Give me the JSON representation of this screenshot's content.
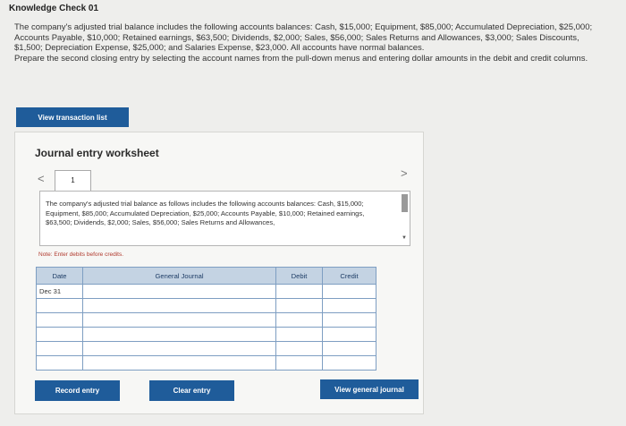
{
  "header": {
    "title": "Knowledge Check 01"
  },
  "problem": {
    "statement": "The company's adjusted trial balance includes the following accounts balances: Cash, $15,000; Equipment, $85,000; Accumulated Depreciation, $25,000; Accounts Payable, $10,000; Retained earnings, $63,500; Dividends, $2,000; Sales, $56,000; Sales Returns and Allowances, $3,000; Sales Discounts, $1,500; Depreciation Expense, $25,000; and Salaries Expense, $23,000. All accounts have normal balances.",
    "instruction": "Prepare the second closing entry by selecting the account names from the pull-down menus and entering dollar amounts in the debit and credit columns."
  },
  "buttons": {
    "view_transaction_list": "View transaction list",
    "record_entry": "Record entry",
    "clear_entry": "Clear entry",
    "view_general_journal": "View general journal"
  },
  "worksheet": {
    "title": "Journal entry worksheet",
    "nav_prev": "<",
    "nav_next": ">",
    "page_number": "1",
    "description": "The company's adjusted trial balance as follows includes the following accounts balances: Cash, $15,000; Equipment, $85,000; Accumulated Depreciation, $25,000; Accounts Payable, $10,000; Retained earnings, $63,500; Dividends, $2,000; Sales, $56,000; Sales Returns and Allowances,",
    "note": "Note: Enter debits before credits."
  },
  "journal": {
    "headers": {
      "date": "Date",
      "account": "General Journal",
      "debit": "Debit",
      "credit": "Credit"
    },
    "rows": [
      {
        "date": "Dec 31",
        "account": "",
        "debit": "",
        "credit": ""
      },
      {
        "date": "",
        "account": "",
        "debit": "",
        "credit": ""
      },
      {
        "date": "",
        "account": "",
        "debit": "",
        "credit": ""
      },
      {
        "date": "",
        "account": "",
        "debit": "",
        "credit": ""
      },
      {
        "date": "",
        "account": "",
        "debit": "",
        "credit": ""
      },
      {
        "date": "",
        "account": "",
        "debit": "",
        "credit": ""
      }
    ]
  },
  "colors": {
    "primary_button": "#1f5c9a",
    "table_header": "#c4d3e3",
    "note_text": "#b03a2e"
  }
}
